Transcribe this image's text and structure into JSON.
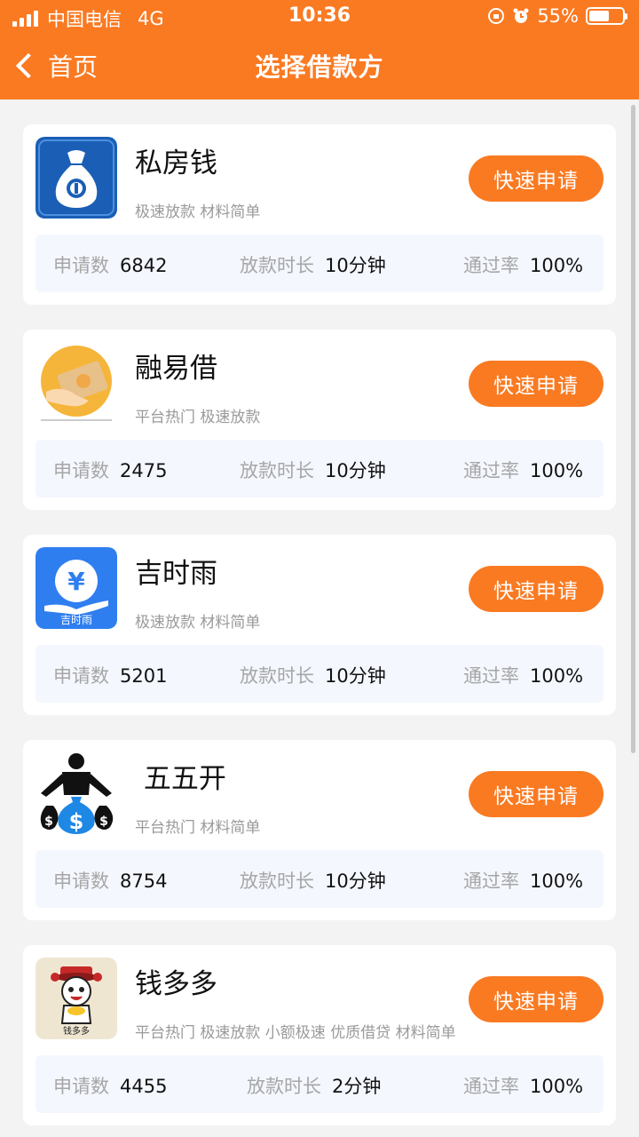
{
  "status_bar": {
    "carrier": "中国电信",
    "network": "4G",
    "time": "10:36",
    "battery": "55%"
  },
  "nav": {
    "back_label": "首页",
    "title": "选择借款方"
  },
  "colors": {
    "brand": "#fa7a22",
    "stats_bg": "#f4f7fe"
  },
  "stat_labels": {
    "applications": "申请数",
    "duration": "放款时长",
    "pass_rate": "通过率"
  },
  "apply_label": "快速申请",
  "lenders": [
    {
      "name": "私房钱",
      "tags": "极速放款 材料简单",
      "applications": "6842",
      "duration": "10分钟",
      "pass_rate": "100%",
      "icon": "money-bag-icon"
    },
    {
      "name": "融易借",
      "tags": "平台热门 极速放款",
      "applications": "2475",
      "duration": "10分钟",
      "pass_rate": "100%",
      "icon": "coin-hand-icon"
    },
    {
      "name": "吉时雨",
      "tags": "极速放款 材料简单",
      "applications": "5201",
      "duration": "10分钟",
      "pass_rate": "100%",
      "icon": "yen-hand-icon",
      "logo_text": "吉时雨"
    },
    {
      "name": " 五五开",
      "tags": "平台热门 材料简单",
      "applications": "8754",
      "duration": "10分钟",
      "pass_rate": "100%",
      "icon": "dollar-bags-icon"
    },
    {
      "name": "钱多多",
      "tags": "平台热门 极速放款 小额极速 优质借贷 材料简单",
      "applications": "4455",
      "duration": "2分钟",
      "pass_rate": "100%",
      "icon": "cartoon-mascot-icon"
    }
  ]
}
